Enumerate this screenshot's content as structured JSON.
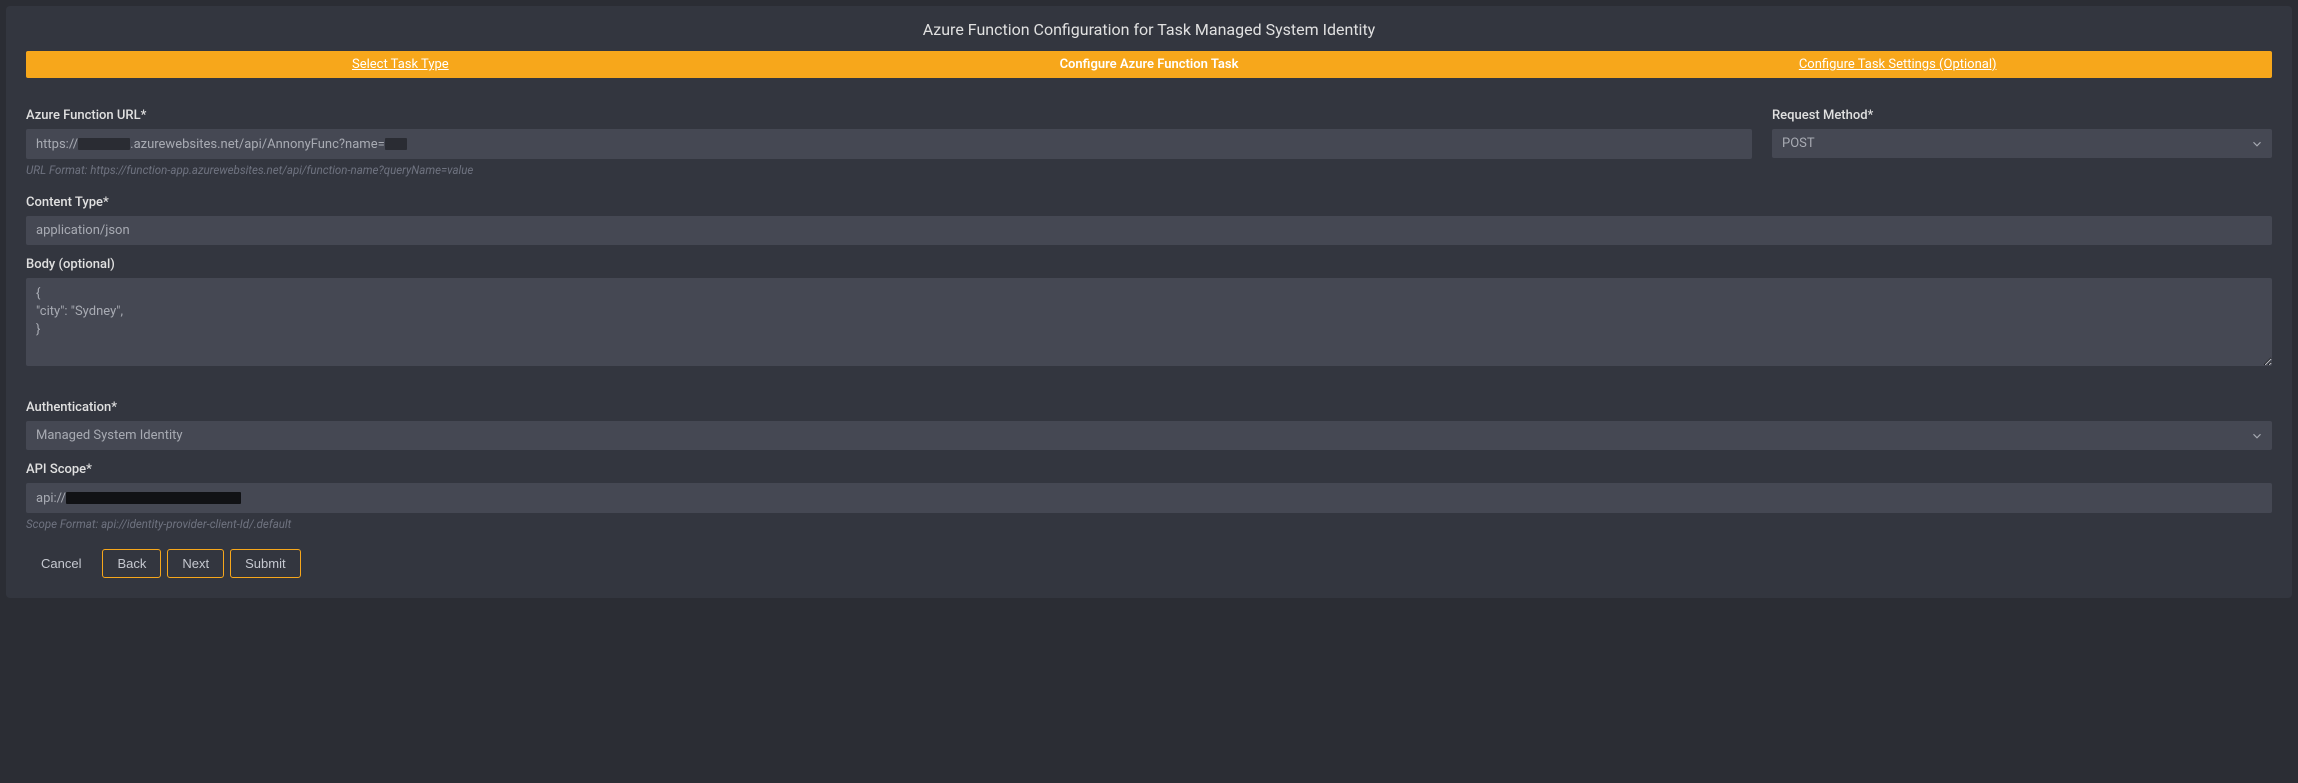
{
  "header": {
    "title": "Azure Function Configuration for Task Managed System Identity"
  },
  "wizard": {
    "step1": "Select Task Type",
    "step2": "Configure Azure Function Task",
    "step3": "Configure Task Settings (Optional)"
  },
  "fields": {
    "url": {
      "label": "Azure Function URL*",
      "prefix": "https://",
      "mid": ".azurewebsites.net/api/AnnonyFunc?name=",
      "helper": "URL Format: https://function-app.azurewebsites.net/api/function-name?queryName=value"
    },
    "method": {
      "label": "Request Method*",
      "value": "POST"
    },
    "contentType": {
      "label": "Content Type*",
      "value": "application/json"
    },
    "body": {
      "label": "Body (optional)",
      "value": "{\n\"city\": \"Sydney\",\n}"
    },
    "auth": {
      "label": "Authentication*",
      "value": "Managed System Identity"
    },
    "apiScope": {
      "label": "API Scope*",
      "prefix": "api://",
      "helper": "Scope Format: api://identity-provider-client-Id/.default"
    }
  },
  "buttons": {
    "cancel": "Cancel",
    "back": "Back",
    "next": "Next",
    "submit": "Submit"
  }
}
